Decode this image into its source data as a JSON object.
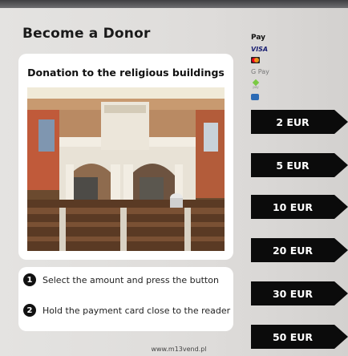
{
  "header": {
    "title": "Become a Donor"
  },
  "card": {
    "title": "Donation to the religious buildings"
  },
  "payment_methods": {
    "apple_pay": " Pay",
    "visa": "VISA",
    "google_pay": "G Pay",
    "pix_pay": "pay"
  },
  "amounts": [
    "2 EUR",
    "5 EUR",
    "10 EUR",
    "20 EUR",
    "30 EUR",
    "50 EUR"
  ],
  "steps": [
    {
      "number": "1",
      "text": "Select the amount and press the button"
    },
    {
      "number": "2",
      "text": "Hold the payment card close to the reader"
    }
  ],
  "footer": {
    "url": "www.m13vend.pl"
  }
}
